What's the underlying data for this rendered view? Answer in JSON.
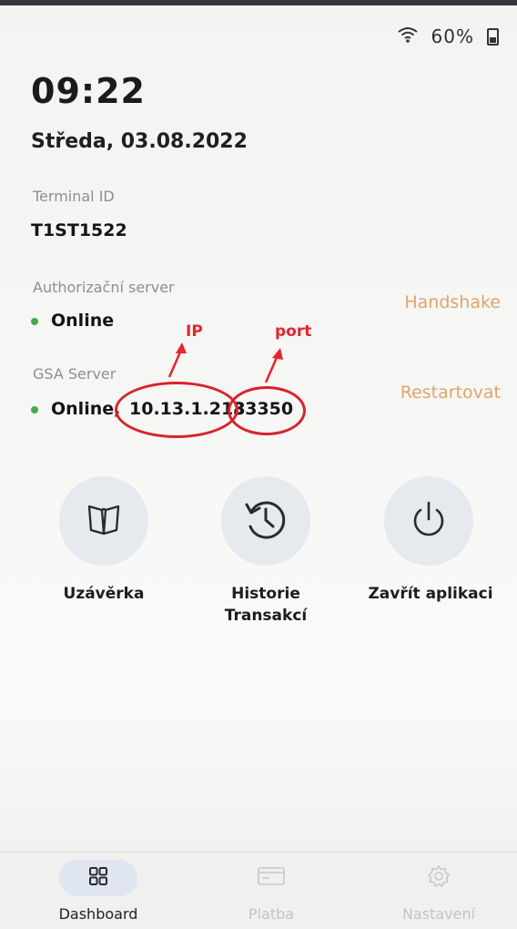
{
  "status_bar": {
    "battery_text": "60%"
  },
  "header": {
    "time": "09:22",
    "date": "Středa, 03.08.2022"
  },
  "terminal": {
    "label": "Terminal ID",
    "value": "T1ST1522"
  },
  "auth_server": {
    "label": "Authorizační server",
    "status": "Online",
    "action": "Handshake"
  },
  "gsa_server": {
    "label": "GSA Server",
    "status": "Online,",
    "ip": "10.13.1.218",
    "port": "33350",
    "action": "Restartovat"
  },
  "annotations": {
    "ip_label": "IP",
    "port_label": "port"
  },
  "tiles": [
    {
      "icon": "book-icon",
      "label_line1": "Uzávěrka",
      "label_line2": ""
    },
    {
      "icon": "history-icon",
      "label_line1": "Historie",
      "label_line2": "Transakcí"
    },
    {
      "icon": "power-icon",
      "label_line1": "Zavřít aplikaci",
      "label_line2": ""
    }
  ],
  "nav": [
    {
      "icon": "dashboard-icon",
      "label": "Dashboard",
      "active": true
    },
    {
      "icon": "card-icon",
      "label": "Platba",
      "active": false
    },
    {
      "icon": "gear-icon",
      "label": "Nastavení",
      "active": false
    }
  ],
  "colors": {
    "accent_action": "#e0a46c",
    "online_dot": "#47a84c",
    "annotation_red": "#e3262f",
    "nav_active_pill": "#dfe5f1"
  }
}
